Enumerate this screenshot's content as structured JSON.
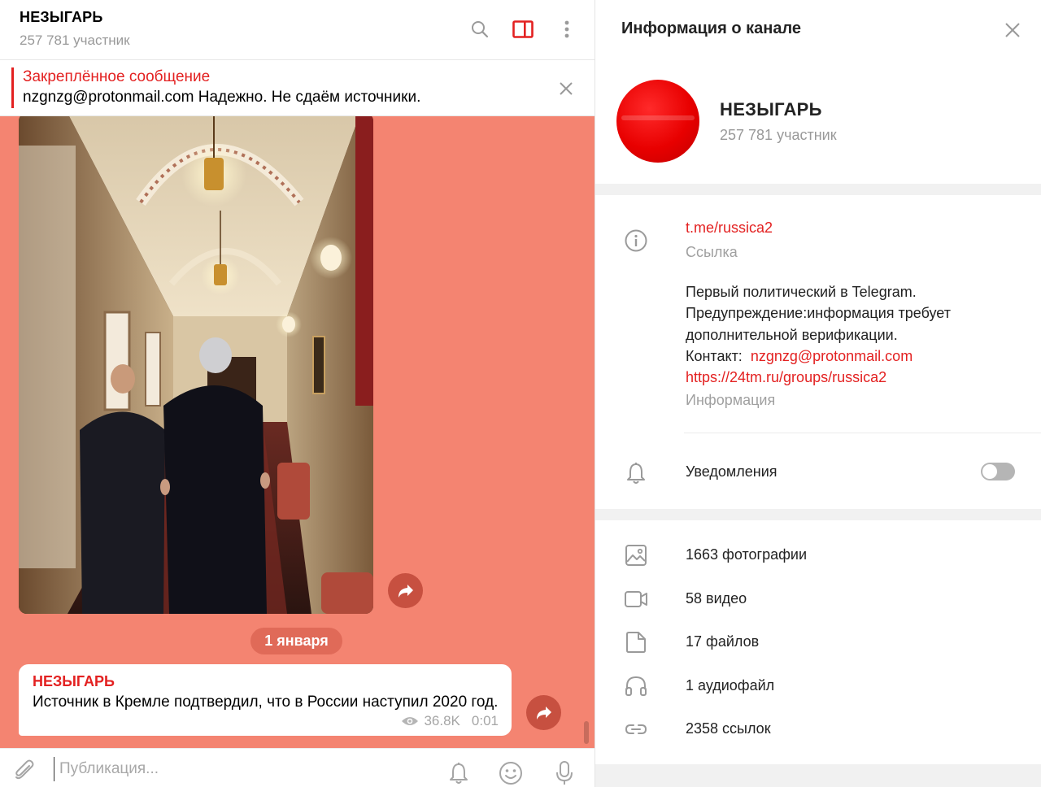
{
  "chat": {
    "title": "НЕЗЫГАРЬ",
    "subscribers": "257 781 участник",
    "pinned": {
      "title": "Закреплённое сообщение",
      "text": "nzgnzg@protonmail.com Надежно. Не сдаём источники."
    },
    "date_separator": "1 января",
    "message": {
      "author": "НЕЗЫГАРЬ",
      "text": "Источник в Кремле подтвердил, что в России наступил 2020 год.",
      "views": "36.8K",
      "time": "0:01"
    },
    "composer": {
      "placeholder": "Публикация..."
    }
  },
  "info": {
    "title": "Информация о канале",
    "channel_name": "НЕЗЫГАРЬ",
    "subscribers": "257 781 участник",
    "link": "t.me/russica2",
    "link_caption": "Ссылка",
    "description_lines": [
      "Первый политический в Telegram.",
      "Предупреждение:информация требует",
      "дополнительной верификации."
    ],
    "contact_label": "Контакт:",
    "contact_email": "nzgnzg@protonmail.com",
    "contact_url": "https://24tm.ru/groups/russica2",
    "description_caption": "Информация",
    "notifications_label": "Уведомления",
    "notifications_on": false,
    "media": [
      {
        "icon": "photo-icon",
        "label": "1663 фотографии"
      },
      {
        "icon": "video-icon",
        "label": "58 видео"
      },
      {
        "icon": "file-icon",
        "label": "17 файлов"
      },
      {
        "icon": "headphones-icon",
        "label": "1 аудиофайл"
      },
      {
        "icon": "link-icon",
        "label": "2358 ссылок"
      }
    ]
  },
  "colors": {
    "accent": "#e32121",
    "chat_background": "#f48471",
    "date_pill": "#e06a58",
    "avatar": "#e80000"
  }
}
